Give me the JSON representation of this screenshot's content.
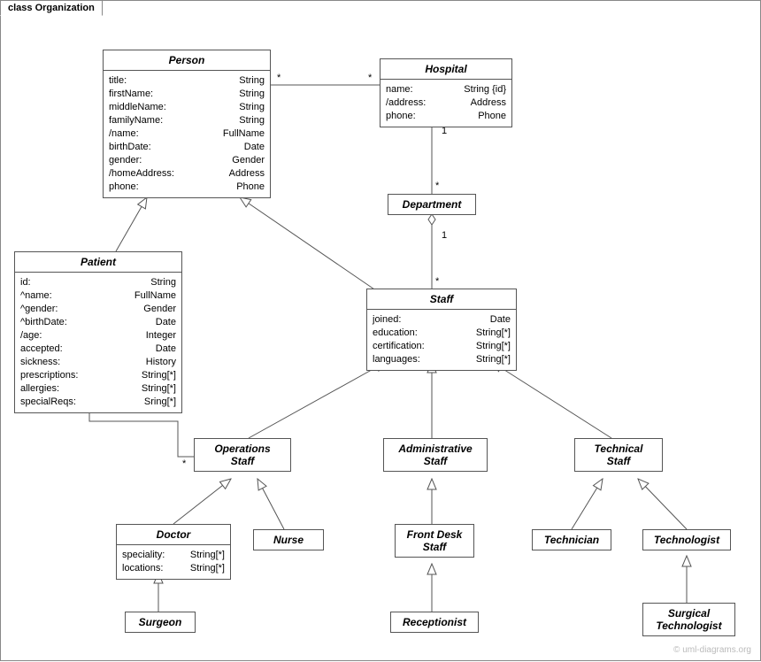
{
  "frame": {
    "label": "class Organization"
  },
  "watermark": "© uml-diagrams.org",
  "classes": {
    "person": {
      "name": "Person",
      "attrs": [
        [
          "title:",
          "String"
        ],
        [
          "firstName:",
          "String"
        ],
        [
          "middleName:",
          "String"
        ],
        [
          "familyName:",
          "String"
        ],
        [
          "/name:",
          "FullName"
        ],
        [
          "birthDate:",
          "Date"
        ],
        [
          "gender:",
          "Gender"
        ],
        [
          "/homeAddress:",
          "Address"
        ],
        [
          "phone:",
          "Phone"
        ]
      ]
    },
    "hospital": {
      "name": "Hospital",
      "attrs": [
        [
          "name:",
          "String {id}"
        ],
        [
          "/address:",
          "Address"
        ],
        [
          "phone:",
          "Phone"
        ]
      ]
    },
    "department": {
      "name": "Department",
      "attrs": []
    },
    "patient": {
      "name": "Patient",
      "attrs": [
        [
          "id:",
          "String"
        ],
        [
          "^name:",
          "FullName"
        ],
        [
          "^gender:",
          "Gender"
        ],
        [
          "^birthDate:",
          "Date"
        ],
        [
          "/age:",
          "Integer"
        ],
        [
          "accepted:",
          "Date"
        ],
        [
          "sickness:",
          "History"
        ],
        [
          "prescriptions:",
          "String[*]"
        ],
        [
          "allergies:",
          "String[*]"
        ],
        [
          "specialReqs:",
          "Sring[*]"
        ]
      ]
    },
    "staff": {
      "name": "Staff",
      "attrs": [
        [
          "joined:",
          "Date"
        ],
        [
          "education:",
          "String[*]"
        ],
        [
          "certification:",
          "String[*]"
        ],
        [
          "languages:",
          "String[*]"
        ]
      ]
    },
    "opsstaff": {
      "name": "Operations\nStaff",
      "attrs": []
    },
    "adminstaff": {
      "name": "Administrative\nStaff",
      "attrs": []
    },
    "techstaff": {
      "name": "Technical\nStaff",
      "attrs": []
    },
    "doctor": {
      "name": "Doctor",
      "attrs": [
        [
          "speciality:",
          "String[*]"
        ],
        [
          "locations:",
          "String[*]"
        ]
      ]
    },
    "nurse": {
      "name": "Nurse",
      "attrs": []
    },
    "frontdesk": {
      "name": "Front Desk\nStaff",
      "attrs": []
    },
    "receptionist": {
      "name": "Receptionist",
      "attrs": []
    },
    "technician": {
      "name": "Technician",
      "attrs": []
    },
    "technologist": {
      "name": "Technologist",
      "attrs": []
    },
    "surgtech": {
      "name": "Surgical\nTechnologist",
      "attrs": []
    }
  },
  "mults": {
    "one": "1",
    "star": "*"
  }
}
